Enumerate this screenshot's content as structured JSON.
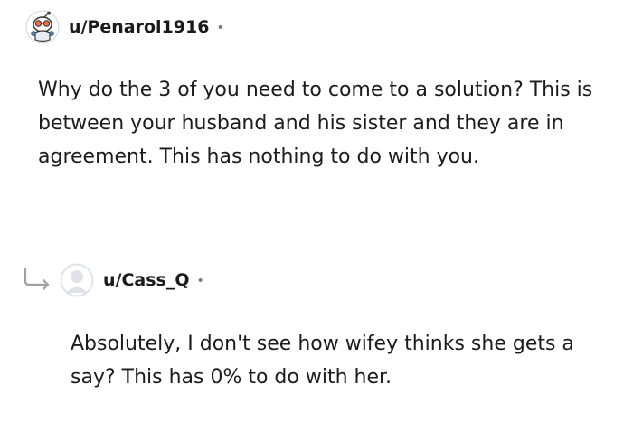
{
  "comments": [
    {
      "username": "u/Penarol1916",
      "separator": "•",
      "text": "Why do the 3 of you need to come to a solution? This is between your husband and his sister and they are in agreement. This has nothing to do with you.",
      "avatar_icon": "snoo-avatar-icon"
    },
    {
      "username": "u/Cass_Q",
      "separator": "•",
      "text": "Absolutely, I don't see how wifey thinks she gets a say? This has 0% to do with her.",
      "avatar_icon": "default-avatar-icon",
      "is_reply": true
    }
  ],
  "colors": {
    "text": "#1c1c1c",
    "meta": "#7c7c7c",
    "reply_arrow": "#a0a0a0"
  }
}
